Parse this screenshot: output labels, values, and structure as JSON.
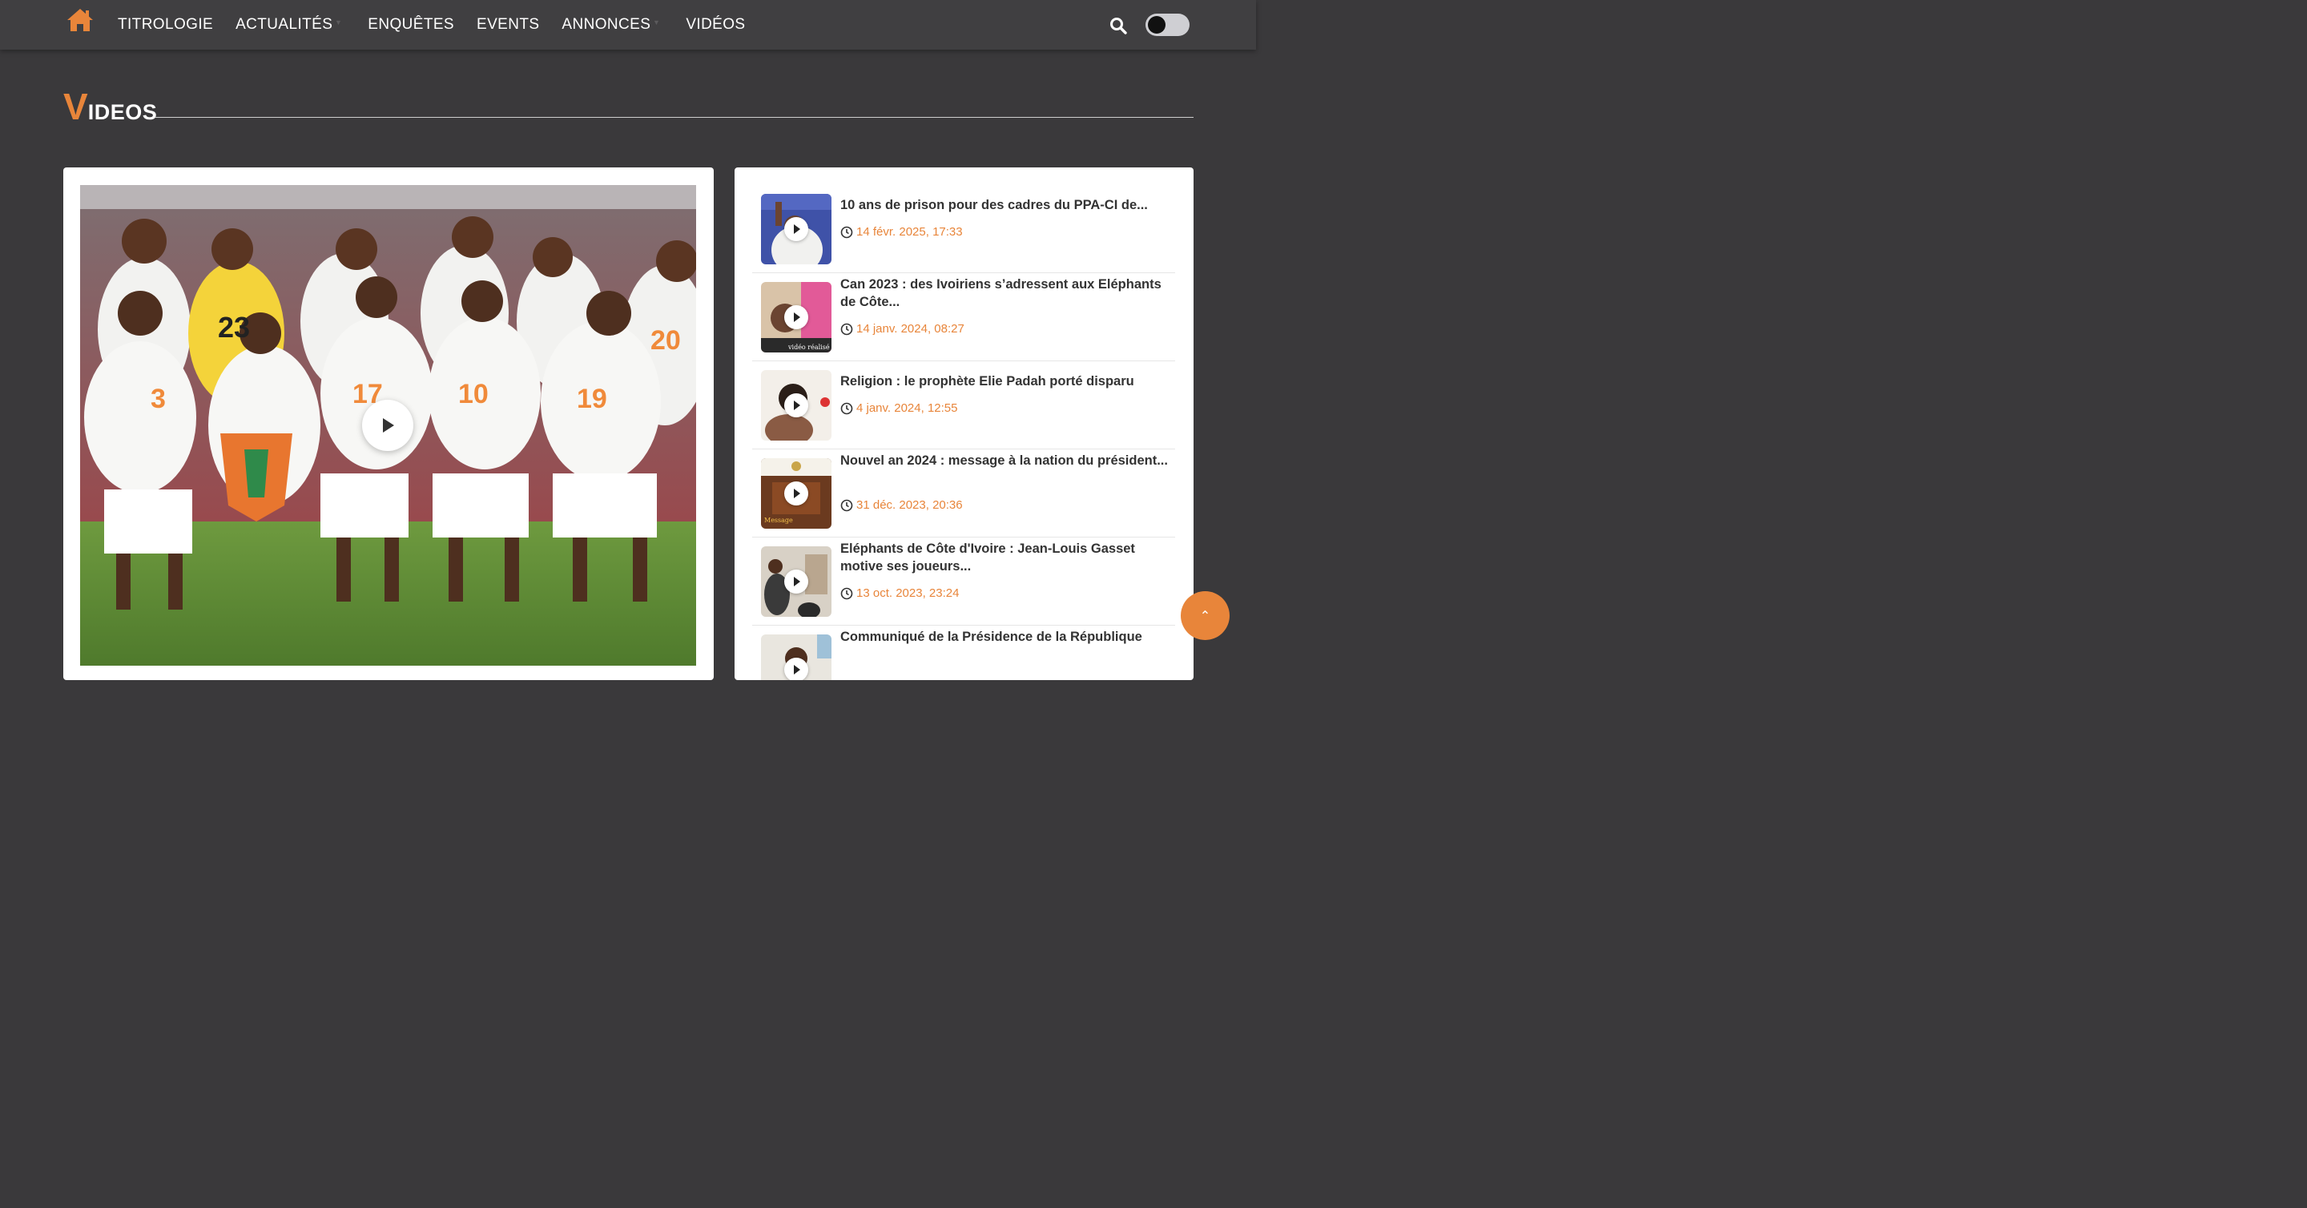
{
  "nav": {
    "items": [
      {
        "label": "TITROLOGIE"
      },
      {
        "label": "ACTUALITÉS"
      },
      {
        "label": "ENQUÊTES"
      },
      {
        "label": "EVENTS"
      },
      {
        "label": "ANNONCES"
      },
      {
        "label": "VIDÉOS"
      }
    ]
  },
  "section": {
    "title_cap": "V",
    "title_rest": "IDEOS"
  },
  "videos": [
    {
      "title": "10 ans de prison pour des cadres du PPA-CI de...",
      "date": "14 févr. 2025, 17:33"
    },
    {
      "title": "Can 2023 : des Ivoiriens s’adressent aux Eléphants de Côte...",
      "date": "14 janv. 2024, 08:27"
    },
    {
      "title": "Religion : le prophète Elie Padah porté disparu",
      "date": "4 janv. 2024, 12:55"
    },
    {
      "title": "Nouvel an 2024 : message à la nation du président...",
      "date": "31 déc. 2023, 20:36"
    },
    {
      "title": "Eléphants de Côte d'Ivoire : Jean-Louis Gasset motive ses joueurs...",
      "date": "13 oct. 2023, 23:24"
    },
    {
      "title": "Communiqué de la Présidence de la République",
      "date": ""
    }
  ],
  "colors": {
    "accent": "#e8853a",
    "background": "#3a393b",
    "header": "#403f41"
  },
  "icons": {
    "home": "home-icon",
    "search": "search-icon",
    "clock": "clock-icon",
    "play": "play-icon",
    "scroll_top": "chevron-double-up-icon"
  }
}
